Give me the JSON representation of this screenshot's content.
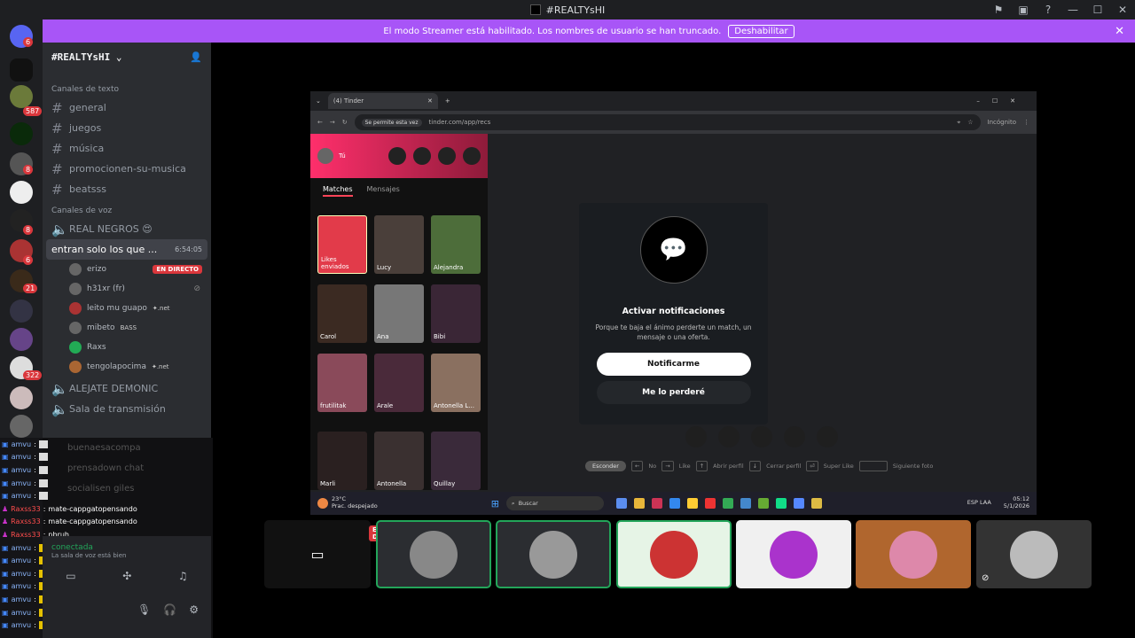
{
  "window": {
    "title": "#REALTYsHI"
  },
  "banner": {
    "text": "El modo Streamer está habilitado. Los nombres de usuario se han truncado.",
    "button": "Deshabilitar"
  },
  "servers": {
    "badges": [
      "6",
      "587",
      "8",
      "8",
      "6",
      "21",
      "322"
    ]
  },
  "channels": {
    "server_name": "#REALTYsHI",
    "text_category": "Canales de texto",
    "text": [
      "general",
      "juegos",
      "música",
      "promocionen-su-musica",
      "beatsss"
    ],
    "voice_category": "Canales de voz",
    "voice": {
      "real_negros": "REAL NEGROS 😍",
      "active": {
        "name": "entran solo los que ...",
        "timer": "6:54:05"
      },
      "users": [
        {
          "name": "erizo",
          "tag": "EN DIRECTO"
        },
        {
          "name": "h31xr (fr)",
          "tag": ""
        },
        {
          "name": "leito mu guapo",
          "tag": "✦.net"
        },
        {
          "name": "mibeto",
          "tag": "BASS"
        },
        {
          "name": "Raxs",
          "tag": ""
        },
        {
          "name": "tengolapocima",
          "tag": "✦.net"
        }
      ],
      "more": [
        "ALEJATE DEMONIC",
        "Sala de transmisión",
        "buenaesacompa",
        "prensadown chat",
        "socialisen giles"
      ]
    }
  },
  "chat": [
    {
      "name": "amvu",
      "msg": "",
      "color": "b"
    },
    {
      "name": "amvu",
      "msg": "",
      "color": "b"
    },
    {
      "name": "amvu",
      "msg": "",
      "color": "b"
    },
    {
      "name": "amvu",
      "msg": "",
      "color": "b"
    },
    {
      "name": "amvu",
      "msg": "",
      "color": "b"
    },
    {
      "name": "Raxss33",
      "msg": "mate-cappgatopensando",
      "color": "r"
    },
    {
      "name": "Raxss33",
      "msg": "mate-cappgatopensando",
      "color": "r"
    },
    {
      "name": "Raxss33",
      "msg": "nbruh",
      "color": "r"
    },
    {
      "name": "amvu",
      "msg": "",
      "color": "b"
    },
    {
      "name": "amvu",
      "msg": "",
      "color": "b"
    },
    {
      "name": "amvu",
      "msg": "",
      "color": "b"
    },
    {
      "name": "amvu",
      "msg": "",
      "color": "b"
    },
    {
      "name": "amvu",
      "msg": "",
      "color": "b"
    },
    {
      "name": "amvu",
      "msg": "",
      "color": "b"
    },
    {
      "name": "amvu",
      "msg": "",
      "color": "b"
    }
  ],
  "voice_panel": {
    "status": "conectada",
    "sub": "La sala de voz está bien"
  },
  "browser": {
    "tab_title": "(4) Tinder",
    "permission": "Se permite esta vez",
    "url": "tinder.com/app/recs",
    "incognito": "Incógnito"
  },
  "tinder": {
    "user": "Tú",
    "tabs": [
      "Matches",
      "Mensajes"
    ],
    "likes_label": "Likes enviados",
    "matches": [
      "Lucy",
      "Alejandra",
      "Carol",
      "Ana",
      "Bibi",
      "frutilitak",
      "Arale",
      "Antonella L...",
      "Marli",
      "Antonella",
      "Quillay"
    ],
    "modal": {
      "title": "Activar notificaciones",
      "body": "Porque te baja el ánimo perderte un match, un mensaje o una oferta.",
      "primary": "Notificarme",
      "secondary": "Me lo perderé"
    },
    "hints": {
      "hide": "Esconder",
      "no": "No",
      "like": "Like",
      "open": "Abrir perfil",
      "close": "Cerrar perfil",
      "super": "Super Like",
      "next": "Siguiente foto"
    }
  },
  "taskbar": {
    "weather_temp": "23°C",
    "weather_desc": "Prac. despejado",
    "search": "Buscar",
    "lang": "ESP LAA",
    "time": "05:12",
    "date": "5/1/2026"
  },
  "stream": {
    "live_badge": "EN DIRECTO"
  }
}
